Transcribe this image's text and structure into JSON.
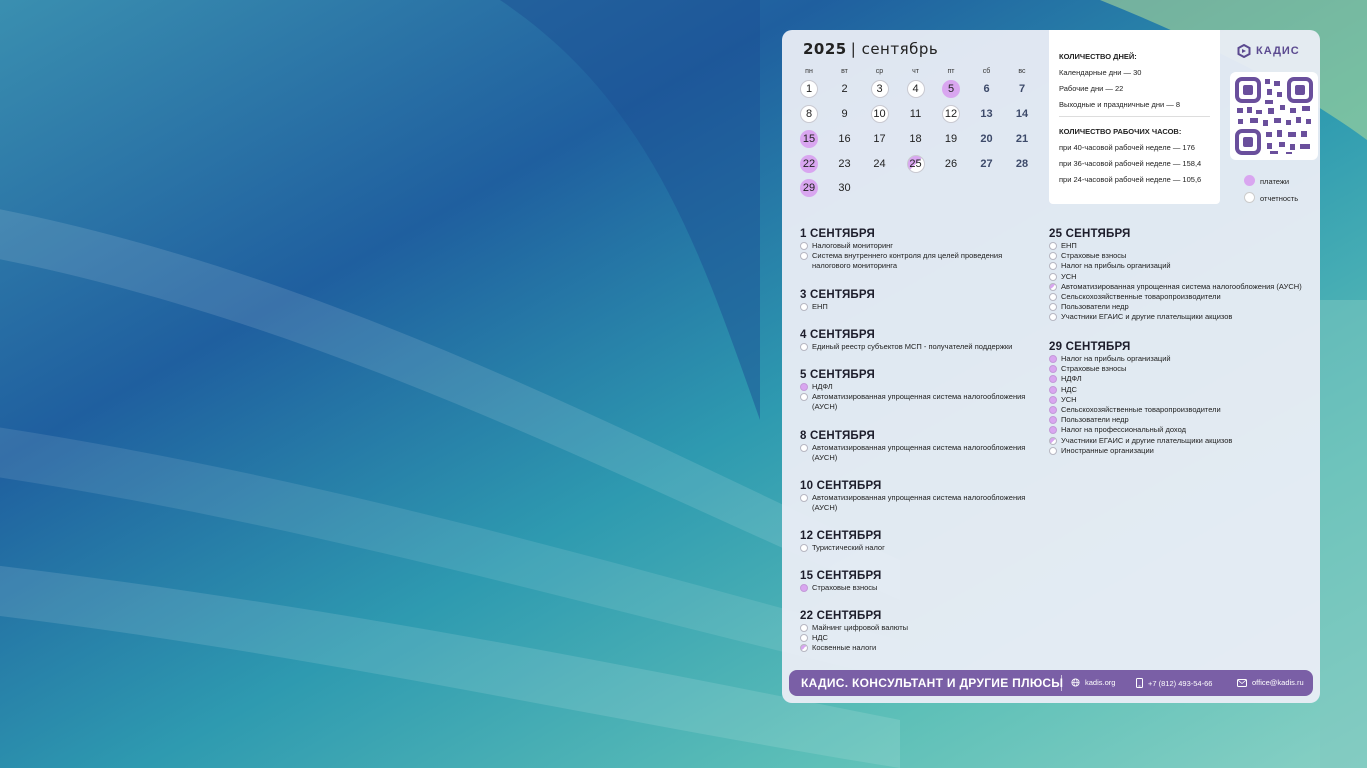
{
  "calendar": {
    "year": "2025",
    "month": "| сентябрь",
    "weekdays": [
      "пн",
      "вт",
      "ср",
      "чт",
      "пт",
      "сб",
      "вс"
    ],
    "days": [
      "1",
      "2",
      "3",
      "4",
      "5",
      "6",
      "7",
      "8",
      "9",
      "10",
      "11",
      "12",
      "13",
      "14",
      "15",
      "16",
      "17",
      "18",
      "19",
      "20",
      "21",
      "22",
      "23",
      "24",
      "25",
      "26",
      "27",
      "28",
      "29",
      "30"
    ]
  },
  "stats": {
    "days_heading": "КОЛИЧЕСТВО ДНЕЙ:",
    "calendar_days": "Календарные дни — 30",
    "work_days": "Рабочие дни — 22",
    "weekend_days": "Выходные и праздничные дни — 8",
    "hours_heading": "КОЛИЧЕСТВО РАБОЧИХ ЧАСОВ:",
    "hours_40": "при 40-часовой рабочей неделе — 176",
    "hours_36": "при 36-часовой рабочей неделе — 158,4",
    "hours_24": "при 24-часовой рабочей неделе — 105,6"
  },
  "brand": {
    "name": "КАДИС"
  },
  "legend": {
    "payments": "платежи",
    "reports": "отчетность"
  },
  "events_left": [
    {
      "date": "1 СЕНТЯБРЯ",
      "items": [
        {
          "t": "Налоговый мониторинг",
          "k": "rep"
        },
        {
          "t": "Система внутреннего контроля для целей проведения налогового мониторинга",
          "k": "rep"
        }
      ]
    },
    {
      "date": "3 СЕНТЯБРЯ",
      "items": [
        {
          "t": "ЕНП",
          "k": "rep"
        }
      ]
    },
    {
      "date": "4 СЕНТЯБРЯ",
      "items": [
        {
          "t": "Единый реестр субъектов МСП - получателей поддержки",
          "k": "rep"
        }
      ]
    },
    {
      "date": "5 СЕНТЯБРЯ",
      "items": [
        {
          "t": "НДФЛ",
          "k": "pay"
        },
        {
          "t": "Автоматизированная упрощенная система налогообложения (АУСН)",
          "k": "rep"
        }
      ]
    },
    {
      "date": "8 СЕНТЯБРЯ",
      "items": [
        {
          "t": "Автоматизированная упрощенная система налогообложения (АУСН)",
          "k": "rep"
        }
      ]
    },
    {
      "date": "10 СЕНТЯБРЯ",
      "items": [
        {
          "t": "Автоматизированная упрощенная система налогообложения (АУСН)",
          "k": "rep"
        }
      ]
    },
    {
      "date": "12 СЕНТЯБРЯ",
      "items": [
        {
          "t": "Туристический налог",
          "k": "rep"
        }
      ]
    },
    {
      "date": "15 СЕНТЯБРЯ",
      "items": [
        {
          "t": "Страховые взносы",
          "k": "pay"
        }
      ]
    },
    {
      "date": "22 СЕНТЯБРЯ",
      "items": [
        {
          "t": "Майнинг цифровой валюты",
          "k": "rep"
        },
        {
          "t": "НДС",
          "k": "rep"
        },
        {
          "t": "Косвенные налоги",
          "k": "both"
        }
      ]
    }
  ],
  "events_right": [
    {
      "date": "25 СЕНТЯБРЯ",
      "items": [
        {
          "t": "ЕНП",
          "k": "rep"
        },
        {
          "t": "Страховые взносы",
          "k": "rep"
        },
        {
          "t": "Налог на прибыль организаций",
          "k": "rep"
        },
        {
          "t": "УСН",
          "k": "rep"
        },
        {
          "t": "Автоматизированная упрощенная система налогообложения (АУСН)",
          "k": "both"
        },
        {
          "t": "Сельскохозяйственные товаропроизводители",
          "k": "rep"
        },
        {
          "t": "Пользователи недр",
          "k": "rep"
        },
        {
          "t": "Участники ЕГАИС и другие плательщики акцизов",
          "k": "rep"
        }
      ]
    },
    {
      "date": "29 СЕНТЯБРЯ",
      "items": [
        {
          "t": "Налог на прибыль организаций",
          "k": "pay"
        },
        {
          "t": "Страховые взносы",
          "k": "pay"
        },
        {
          "t": "НДФЛ",
          "k": "pay"
        },
        {
          "t": "НДС",
          "k": "pay"
        },
        {
          "t": "УСН",
          "k": "pay"
        },
        {
          "t": "Сельскохозяйственные товаропроизводители",
          "k": "pay"
        },
        {
          "t": "Пользователи недр",
          "k": "pay"
        },
        {
          "t": "Налог на профессиональный доход",
          "k": "pay"
        },
        {
          "t": "Участники ЕГАИС и другие плательщики акцизов",
          "k": "both"
        },
        {
          "t": "Иностранные организации",
          "k": "rep"
        }
      ]
    }
  ],
  "footer": {
    "tagline": "КАДИС. КОНСУЛЬТАНТ И ДРУГИЕ ПЛЮСЫ",
    "site": "kadis.org",
    "phone": "+7 (812) 493-54-66",
    "email": "office@kadis.ru"
  },
  "colors": {
    "accent": "#7a5fa6",
    "payment": "#d9a6f0"
  }
}
